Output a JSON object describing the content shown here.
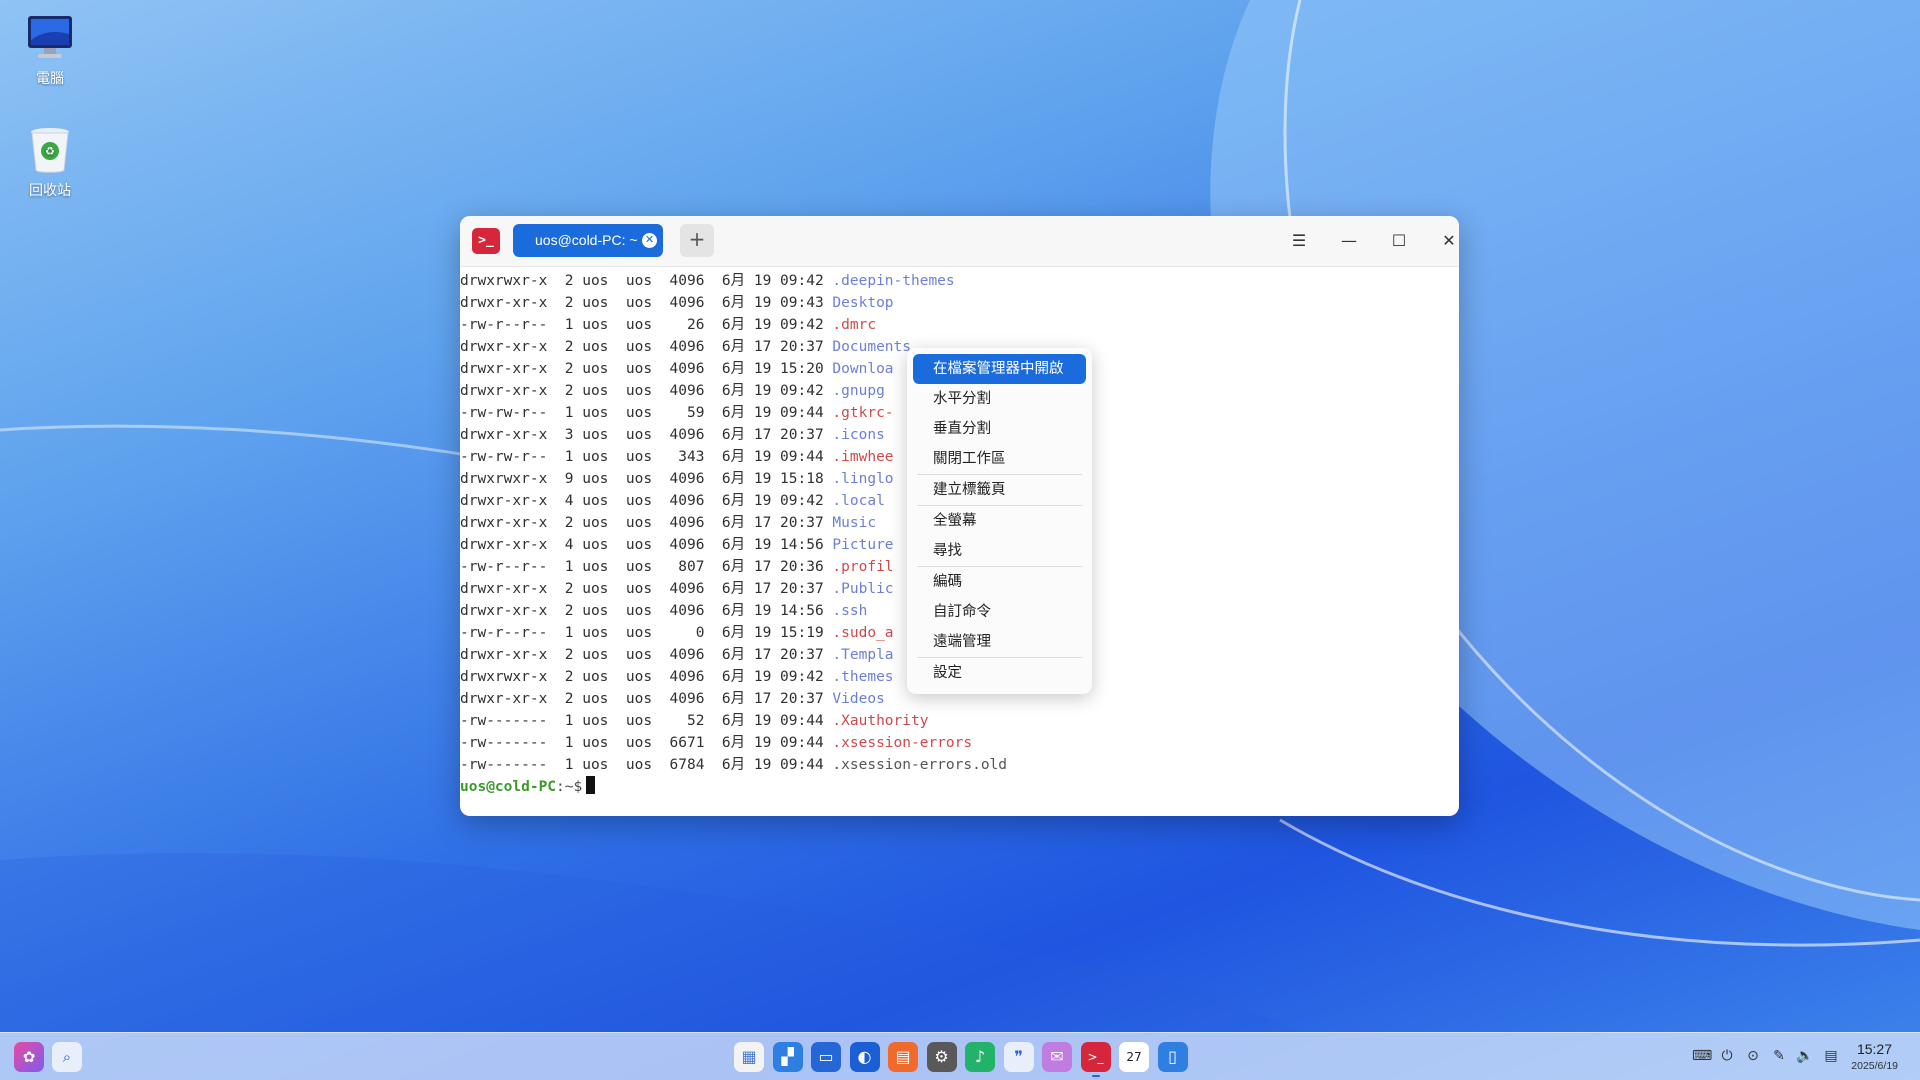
{
  "desktop": {
    "icons": [
      {
        "label": "電腦",
        "icon": "computer-icon"
      },
      {
        "label": "回收站",
        "icon": "trash-icon"
      }
    ]
  },
  "terminal": {
    "tab_title": "uos@cold-PC: ~",
    "listing": [
      {
        "perm": "drwxrwxr-x",
        "links": "2",
        "user": "uos",
        "group": "uos",
        "size": "4096",
        "month": "6月",
        "day": "19",
        "time": "09:42",
        "name": ".deepin-themes",
        "kind": "dir"
      },
      {
        "perm": "drwxr-xr-x",
        "links": "2",
        "user": "uos",
        "group": "uos",
        "size": "4096",
        "month": "6月",
        "day": "19",
        "time": "09:43",
        "name": "Desktop",
        "kind": "dir"
      },
      {
        "perm": "-rw-r--r--",
        "links": "1",
        "user": "uos",
        "group": "uos",
        "size": "26",
        "month": "6月",
        "day": "19",
        "time": "09:42",
        "name": ".dmrc",
        "kind": "red"
      },
      {
        "perm": "drwxr-xr-x",
        "links": "2",
        "user": "uos",
        "group": "uos",
        "size": "4096",
        "month": "6月",
        "day": "17",
        "time": "20:37",
        "name": "Documents",
        "kind": "dir"
      },
      {
        "perm": "drwxr-xr-x",
        "links": "2",
        "user": "uos",
        "group": "uos",
        "size": "4096",
        "month": "6月",
        "day": "19",
        "time": "15:20",
        "name": "Downloa",
        "kind": "dir"
      },
      {
        "perm": "drwxr-xr-x",
        "links": "2",
        "user": "uos",
        "group": "uos",
        "size": "4096",
        "month": "6月",
        "day": "19",
        "time": "09:42",
        "name": ".gnupg",
        "kind": "dir"
      },
      {
        "perm": "-rw-rw-r--",
        "links": "1",
        "user": "uos",
        "group": "uos",
        "size": "59",
        "month": "6月",
        "day": "19",
        "time": "09:44",
        "name": ".gtkrc-",
        "kind": "red"
      },
      {
        "perm": "drwxr-xr-x",
        "links": "3",
        "user": "uos",
        "group": "uos",
        "size": "4096",
        "month": "6月",
        "day": "17",
        "time": "20:37",
        "name": ".icons",
        "kind": "dir"
      },
      {
        "perm": "-rw-rw-r--",
        "links": "1",
        "user": "uos",
        "group": "uos",
        "size": "343",
        "month": "6月",
        "day": "19",
        "time": "09:44",
        "name": ".imwhee",
        "kind": "red"
      },
      {
        "perm": "drwxrwxr-x",
        "links": "9",
        "user": "uos",
        "group": "uos",
        "size": "4096",
        "month": "6月",
        "day": "19",
        "time": "15:18",
        "name": ".linglo",
        "kind": "dir"
      },
      {
        "perm": "drwxr-xr-x",
        "links": "4",
        "user": "uos",
        "group": "uos",
        "size": "4096",
        "month": "6月",
        "day": "19",
        "time": "09:42",
        "name": ".local",
        "kind": "dir"
      },
      {
        "perm": "drwxr-xr-x",
        "links": "2",
        "user": "uos",
        "group": "uos",
        "size": "4096",
        "month": "6月",
        "day": "17",
        "time": "20:37",
        "name": "Music",
        "kind": "dir"
      },
      {
        "perm": "drwxr-xr-x",
        "links": "4",
        "user": "uos",
        "group": "uos",
        "size": "4096",
        "month": "6月",
        "day": "19",
        "time": "14:56",
        "name": "Picture",
        "kind": "dir"
      },
      {
        "perm": "-rw-r--r--",
        "links": "1",
        "user": "uos",
        "group": "uos",
        "size": "807",
        "month": "6月",
        "day": "17",
        "time": "20:36",
        "name": ".profil",
        "kind": "red"
      },
      {
        "perm": "drwxr-xr-x",
        "links": "2",
        "user": "uos",
        "group": "uos",
        "size": "4096",
        "month": "6月",
        "day": "17",
        "time": "20:37",
        "name": ".Public",
        "kind": "dir"
      },
      {
        "perm": "drwxr-xr-x",
        "links": "2",
        "user": "uos",
        "group": "uos",
        "size": "4096",
        "month": "6月",
        "day": "19",
        "time": "14:56",
        "name": ".ssh",
        "kind": "dir"
      },
      {
        "perm": "-rw-r--r--",
        "links": "1",
        "user": "uos",
        "group": "uos",
        "size": "0",
        "month": "6月",
        "day": "19",
        "time": "15:19",
        "name": ".sudo_a",
        "kind": "red"
      },
      {
        "perm": "drwxr-xr-x",
        "links": "2",
        "user": "uos",
        "group": "uos",
        "size": "4096",
        "month": "6月",
        "day": "17",
        "time": "20:37",
        "name": ".Templa",
        "kind": "dir"
      },
      {
        "perm": "drwxrwxr-x",
        "links": "2",
        "user": "uos",
        "group": "uos",
        "size": "4096",
        "month": "6月",
        "day": "19",
        "time": "09:42",
        "name": ".themes",
        "kind": "dir"
      },
      {
        "perm": "drwxr-xr-x",
        "links": "2",
        "user": "uos",
        "group": "uos",
        "size": "4096",
        "month": "6月",
        "day": "17",
        "time": "20:37",
        "name": "Videos",
        "kind": "dir"
      },
      {
        "perm": "-rw-------",
        "links": "1",
        "user": "uos",
        "group": "uos",
        "size": "52",
        "month": "6月",
        "day": "19",
        "time": "09:44",
        "name": ".Xauthority",
        "kind": "red"
      },
      {
        "perm": "-rw-------",
        "links": "1",
        "user": "uos",
        "group": "uos",
        "size": "6671",
        "month": "6月",
        "day": "19",
        "time": "09:44",
        "name": ".xsession-errors",
        "kind": "red"
      },
      {
        "perm": "-rw-------",
        "links": "1",
        "user": "uos",
        "group": "uos",
        "size": "6784",
        "month": "6月",
        "day": "19",
        "time": "09:44",
        "name": ".xsession-errors.old",
        "kind": "plain"
      }
    ],
    "prompt_user": "uos@cold-PC",
    "prompt_path": ":~$"
  },
  "context_menu": {
    "groups": [
      [
        "在檔案管理器中開啟",
        "水平分割",
        "垂直分割",
        "關閉工作區"
      ],
      [
        "建立標籤頁"
      ],
      [
        "全螢幕",
        "尋找"
      ],
      [
        "編碼",
        "自訂命令",
        "遠端管理"
      ],
      [
        "設定"
      ]
    ],
    "active_index": 0
  },
  "taskbar": {
    "left_icons": [
      "launcher-icon",
      "search-icon"
    ],
    "center_icons": [
      {
        "name": "app-grid-icon",
        "color": "#f3f3f3",
        "glyph": "▦",
        "fg": "#4a7bd8"
      },
      {
        "name": "multitask-view-icon",
        "color": "#2f7fe0",
        "glyph": "▞",
        "fg": "#ffffff"
      },
      {
        "name": "file-manager-icon",
        "color": "#2567d6",
        "glyph": "▭",
        "fg": "#ffffff"
      },
      {
        "name": "browser-icon",
        "color": "#1c5fd4",
        "glyph": "◐",
        "fg": "#ffffff"
      },
      {
        "name": "app-store-icon",
        "color": "#f06a2e",
        "glyph": "▤",
        "fg": "#ffffff"
      },
      {
        "name": "settings-icon",
        "color": "#595959",
        "glyph": "⚙",
        "fg": "#ffffff"
      },
      {
        "name": "music-icon",
        "color": "#22b26a",
        "glyph": "♪",
        "fg": "#ffffff"
      },
      {
        "name": "chat-icon",
        "color": "#e9eefb",
        "glyph": "❞",
        "fg": "#2f5fd0"
      },
      {
        "name": "mail-icon",
        "color": "#c07ce0",
        "glyph": "✉",
        "fg": "#ffffff"
      },
      {
        "name": "terminal-icon",
        "color": "#d6263b",
        "glyph": ">_",
        "fg": "#ffffff"
      },
      {
        "name": "calendar-icon",
        "color": "#ffffff",
        "glyph": "27",
        "fg": "#222222"
      },
      {
        "name": "control-center-icon",
        "color": "#2f7fe0",
        "glyph": "▯",
        "fg": "#ffffff"
      }
    ],
    "clock_time": "15:27",
    "clock_date": "2025/6/19"
  }
}
